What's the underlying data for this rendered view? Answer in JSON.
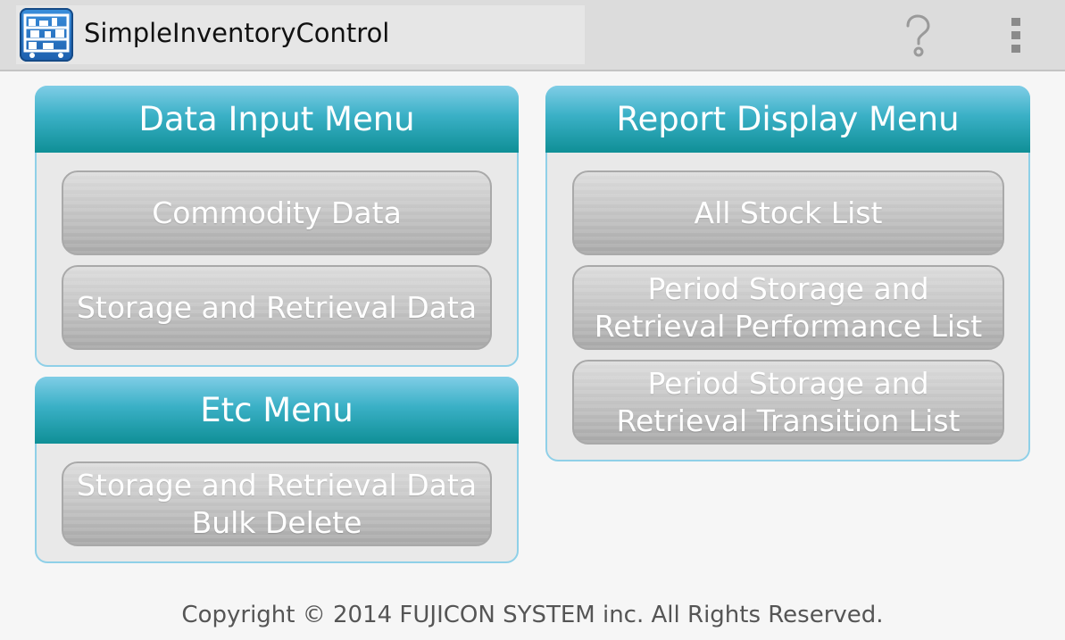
{
  "action_bar": {
    "app_title": "SimpleInventoryControl",
    "app_icon": "inventory-shelf-icon",
    "help_icon": "question-mark-icon",
    "overflow_icon": "vertical-dots-icon"
  },
  "colors": {
    "action_bar_bg": "#dcdcdc",
    "panel_header": "#1f9fae",
    "panel_border": "#8fd0e8",
    "button_gray": "#b8b8b8",
    "page_bg": "#f6f6f6"
  },
  "data_input_menu": {
    "title": "Data Input Menu",
    "buttons": [
      "Commodity Data",
      "Storage and Retrieval Data"
    ]
  },
  "etc_menu": {
    "title": "Etc Menu",
    "buttons": [
      "Storage and Retrieval Data\nBulk Delete"
    ]
  },
  "report_display_menu": {
    "title": "Report Display Menu",
    "buttons": [
      "All Stock List",
      "Period Storage and\nRetrieval Performance List",
      "Period Storage and\nRetrieval Transition List"
    ]
  },
  "footer": {
    "copyright": "Copyright © 2014 FUJICON SYSTEM inc. All Rights Reserved."
  }
}
